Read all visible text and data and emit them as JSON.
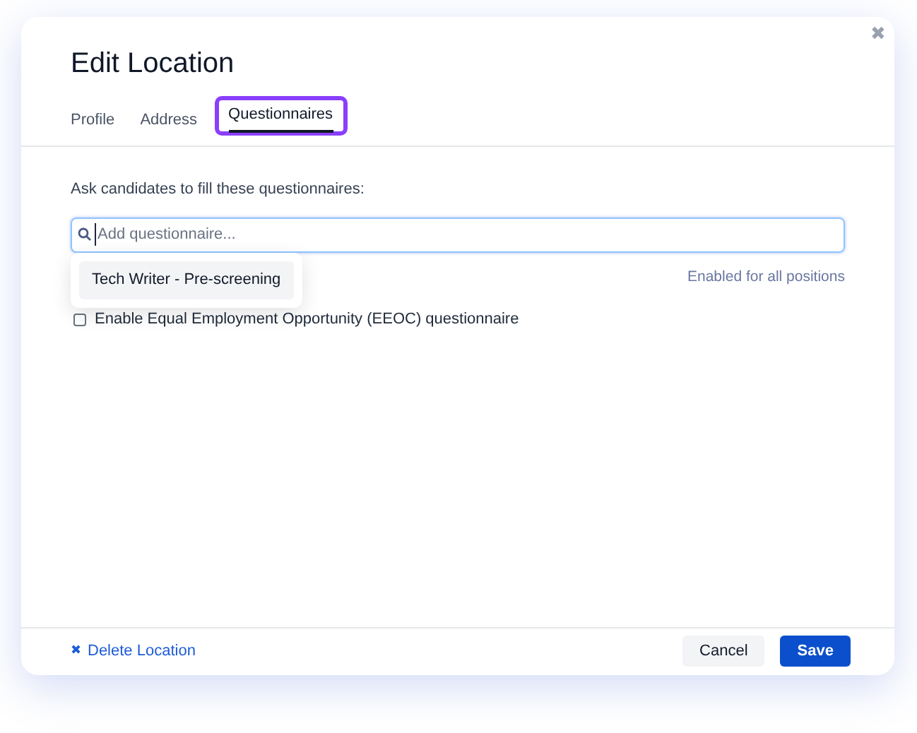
{
  "dialog": {
    "title": "Edit Location",
    "close_icon": "✖"
  },
  "tabs": [
    {
      "label": "Profile",
      "selected": false
    },
    {
      "label": "Address",
      "selected": false
    },
    {
      "label": "Questionnaires",
      "selected": true
    }
  ],
  "prompt": "Ask candidates to fill these questionnaires:",
  "search": {
    "placeholder": "Add questionnaire..."
  },
  "suggestions": [
    {
      "label": "Tech Writer - Pre-screening",
      "selected": true
    }
  ],
  "enabled_note": "Enabled for all positions",
  "eeoc": {
    "label": "Enable Equal Employment Opportunity (EEOC) questionnaire",
    "checked": false
  },
  "footer": {
    "delete_icon": "✖",
    "delete_label": "Delete Location",
    "cancel": "Cancel",
    "save": "Save"
  }
}
